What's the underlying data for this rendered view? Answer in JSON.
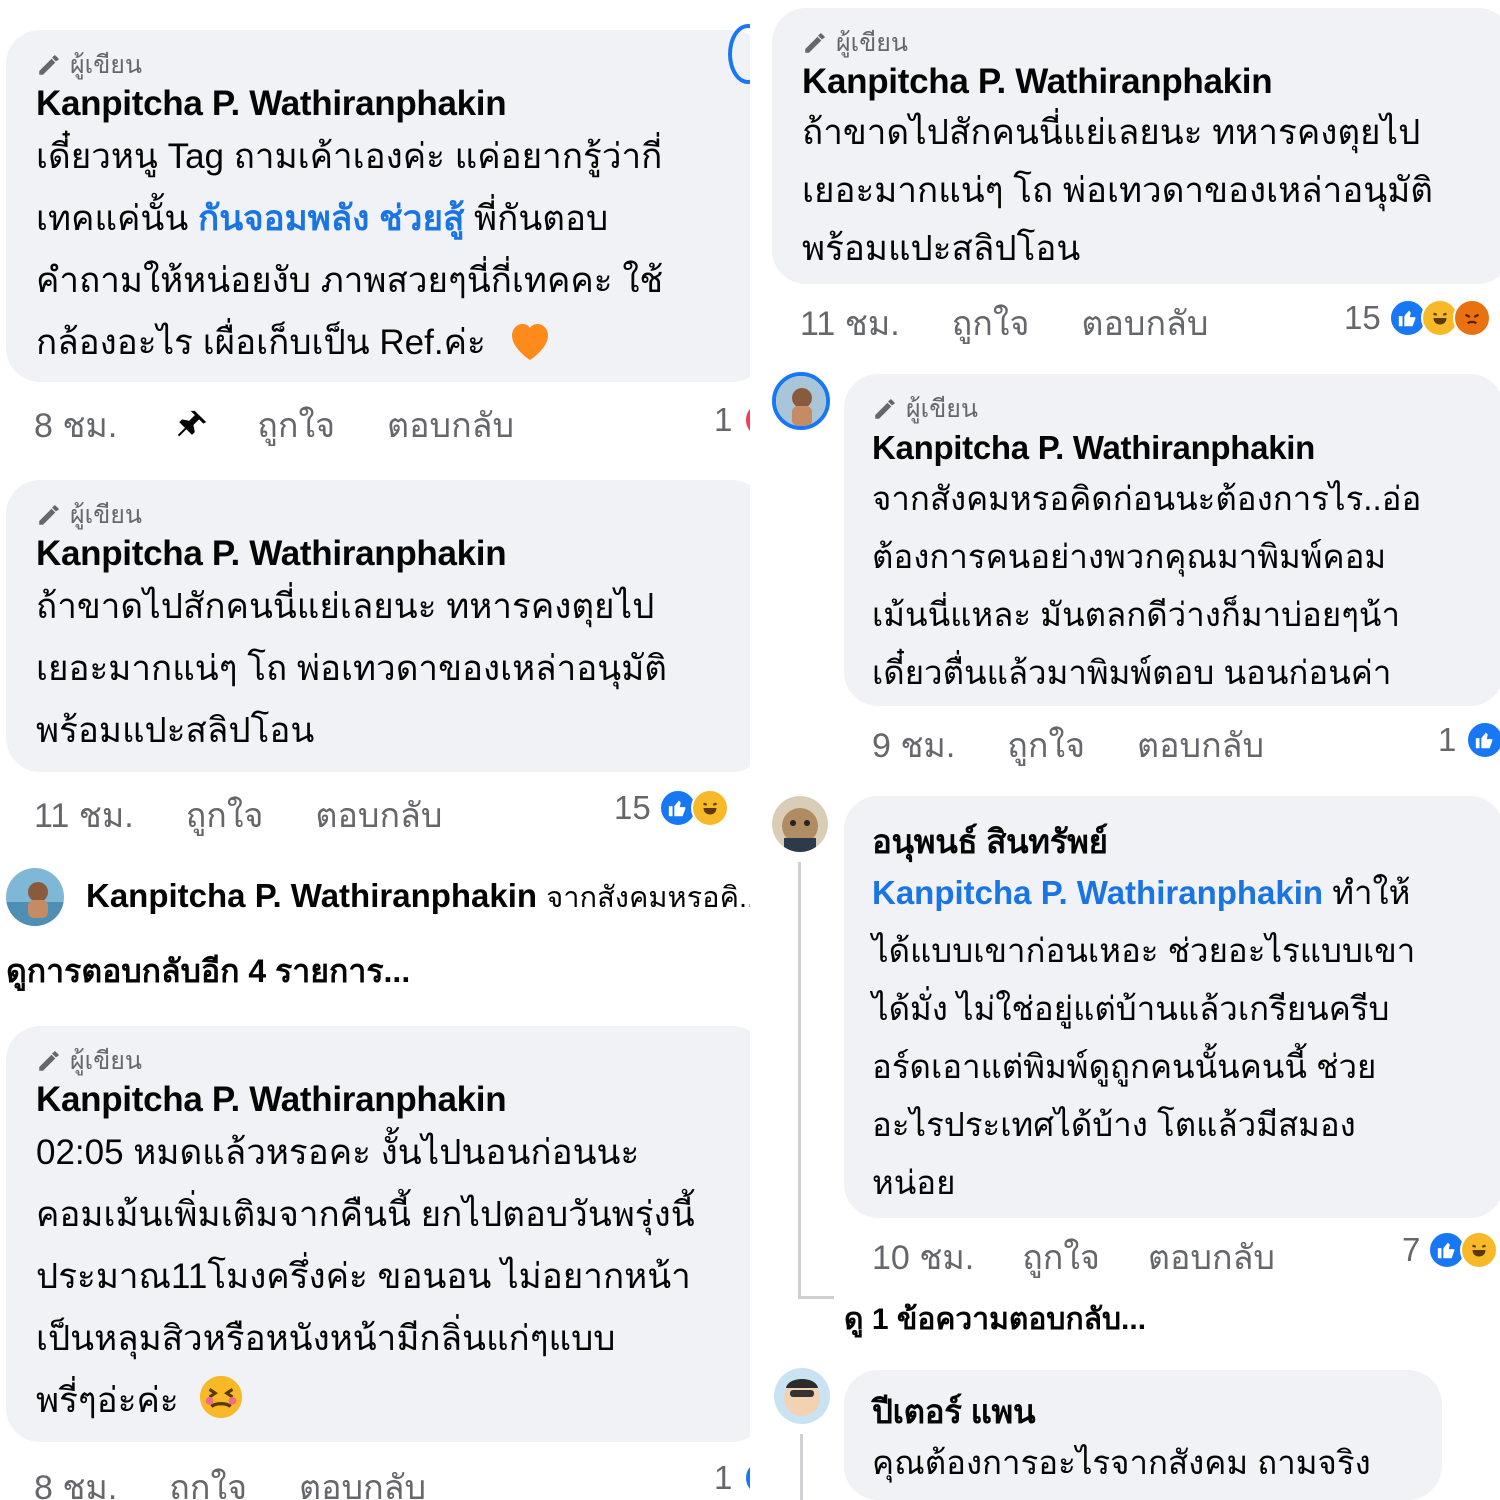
{
  "left": {
    "c1": {
      "author_badge": "ผู้เขียน",
      "name": "Kanpitcha P. Wathiranphakin",
      "line1": "เดี๋ยวหนู Tag ถามเค้าเองค่ะ แค่อยากรู้ว่ากี่",
      "line2a": "เทคแค่นั้น ",
      "mention": "กันจอมพลัง ช่วยสู้",
      "line2b": " พี่กันตอบ",
      "line3": "คำถามให้หน่อยงับ ภาพสวยๆนี่กี่เทคคะ ใช้",
      "line4": "กล้องอะไร เผื่อเก็บเป็น Ref.ค่ะ",
      "time": "8 ชม.",
      "like": "ถูกใจ",
      "reply": "ตอบกลับ",
      "count": "1"
    },
    "c2": {
      "author_badge": "ผู้เขียน",
      "name": "Kanpitcha P. Wathiranphakin",
      "line1": "ถ้าขาดไปสักคนนี่แย่เลยนะ ทหารคงตุยไป",
      "line2": "เยอะมากแน่ๆ โถ พ่อเทวดาของเหล่าอนุมัติ",
      "line3": "พร้อมแปะสลิปโอน",
      "time": "11 ชม.",
      "like": "ถูกใจ",
      "reply": "ตอบกลับ",
      "count": "15"
    },
    "preview": {
      "name": "Kanpitcha P. Wathiranphakin",
      "snippet": "จากสังคมหรอคิ..."
    },
    "view_more": "ดูการตอบกลับอีก 4 รายการ...",
    "c3": {
      "author_badge": "ผู้เขียน",
      "name": "Kanpitcha P. Wathiranphakin",
      "line1": "02:05 หมดแล้วหรอคะ งั้นไปนอนก่อนนะ",
      "line2": "คอมเม้นเพิ่มเติมจากคืนนี้ ยกไปตอบวันพรุ่งนี้",
      "line3": "ประมาณ11โมงครึ่งค่ะ ขอนอน ไม่อยากหน้า",
      "line4": "เป็นหลุมสิวหรือหนังหน้ามีกลิ่นแก่ๆแบบ",
      "line5": "พรี่ๆอ่ะค่ะ",
      "time": "8 ชม.",
      "like": "ถูกใจ",
      "reply": "ตอบกลับ",
      "count": "1"
    }
  },
  "right": {
    "c1": {
      "author_badge": "ผู้เขียน",
      "name": "Kanpitcha P. Wathiranphakin",
      "line1": "ถ้าขาดไปสักคนนี่แย่เลยนะ ทหารคงตุยไป",
      "line2": "เยอะมากแน่ๆ โถ พ่อเทวดาของเหล่าอนุมัติ",
      "line3": "พร้อมแปะสลิปโอน",
      "time": "11 ชม.",
      "like": "ถูกใจ",
      "reply": "ตอบกลับ",
      "count": "15"
    },
    "c2": {
      "author_badge": "ผู้เขียน",
      "name": "Kanpitcha P. Wathiranphakin",
      "line1": "จากสังคมหรอคิดก่อนนะต้องการไร..อ่อ",
      "line2": "ต้องการคนอย่างพวกคุณมาพิมพ์คอม",
      "line3": "เม้นนี่แหละ มันตลกดีว่างก็มาบ่อยๆน้า",
      "line4": "เดี๋ยวตื่นแล้วมาพิมพ์ตอบ นอนก่อนค่า",
      "time": "9 ชม.",
      "like": "ถูกใจ",
      "reply": "ตอบกลับ",
      "count": "1"
    },
    "c3": {
      "name": "อนุพนธ์ สินทรัพย์",
      "mention": "Kanpitcha P. Wathiranphakin",
      "line1b": " ทำให้",
      "line2": "ได้แบบเขาก่อนเหอะ ช่วยอะไรแบบเขา",
      "line3": "ได้มั่ง ไม่ใช่อยู่แต่บ้านแล้วเกรียนครีบ",
      "line4": "อร์ดเอาแต่พิมพ์ดูถูกคนนั้นคนนี้ ช่วย",
      "line5": "อะไรประเทศได้บ้าง โตแล้วมีสมอง",
      "line6": "หน่อย",
      "time": "10 ชม.",
      "like": "ถูกใจ",
      "reply": "ตอบกลับ",
      "count": "7",
      "view_reply": "ดู 1 ข้อความตอบกลับ..."
    },
    "c4": {
      "name": "ปีเตอร์ แพน",
      "line1": "คุณต้องการอะไรจากสังคม ถามจริง"
    }
  },
  "colors": {
    "bubble": "#f0f2f5",
    "meta_text": "#65676b",
    "mention": "#1b74e4",
    "like_blue": "#1877f2",
    "haha_yellow": "#f7b928"
  },
  "icons": [
    "pencil-icon",
    "pin-icon",
    "like-reaction-icon",
    "haha-reaction-icon",
    "angry-reaction-icon",
    "love-reaction-icon",
    "orange-heart-icon",
    "tired-face-icon"
  ]
}
